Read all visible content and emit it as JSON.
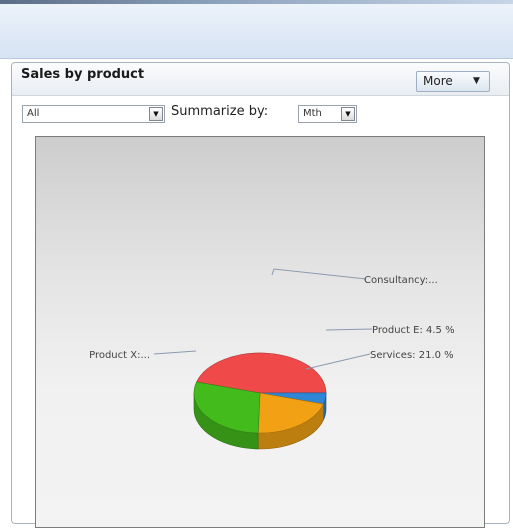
{
  "panel": {
    "title": "Sales by product",
    "more_label": "More",
    "filter_value": "All",
    "summarize_label": "Summarize by:",
    "summarize_value": "Mth"
  },
  "colors": {
    "consultancy": "#f0494a",
    "product_e": "#2f86d6",
    "services": "#f2a114",
    "product_x": "#44bb1c"
  },
  "chart_data": {
    "type": "pie",
    "labels": [
      "Consultancy:...",
      "Product E: 4.5 %",
      "Services: 21.0 %",
      "Product X:..."
    ],
    "slices": [
      {
        "name": "Consultancy",
        "label": "Consultancy:...",
        "value": 45.5
      },
      {
        "name": "Product E",
        "label": "Product E: 4.5 %",
        "value": 4.5
      },
      {
        "name": "Services",
        "label": "Services: 21.0 %",
        "value": 21.0
      },
      {
        "name": "Product X",
        "label": "Product X:...",
        "value": 29.0
      }
    ]
  }
}
